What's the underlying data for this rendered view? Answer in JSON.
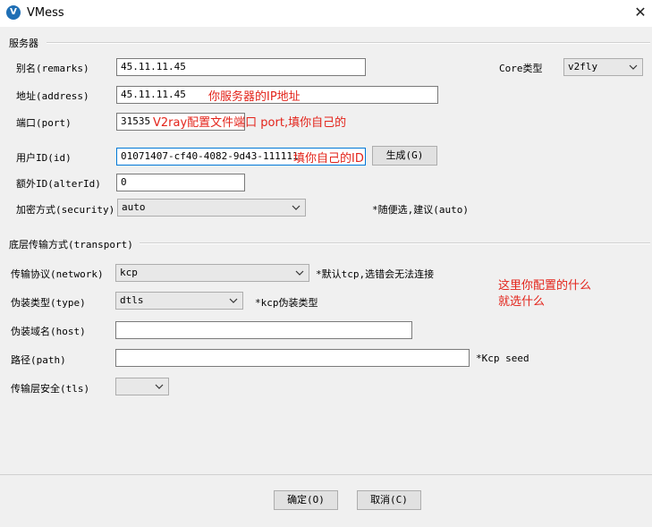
{
  "window": {
    "title": "VMess",
    "icon_letter": "V"
  },
  "server_group": {
    "title": "服务器"
  },
  "fields": {
    "remarks": {
      "label": "别名(remarks)",
      "value": "45.11.11.45"
    },
    "core_type": {
      "label": "Core类型",
      "value": "v2fly"
    },
    "address": {
      "label": "地址(address)",
      "value": "45.11.11.45",
      "note": "你服务器的IP地址"
    },
    "port": {
      "label": "端口(port)",
      "value": "31535",
      "note": "V2ray配置文件端口 port,填你自己的"
    },
    "id": {
      "label": "用户ID(id)",
      "value": "01071407-cf40-4082-9d43-111111",
      "note": "填你自己的ID"
    },
    "generate_button": "生成(G)",
    "alter_id": {
      "label": "额外ID(alterId)",
      "value": "0"
    },
    "security": {
      "label": "加密方式(security)",
      "value": "auto",
      "hint": "*随便选,建议(auto)"
    }
  },
  "transport_group": {
    "title": "底层传输方式(transport)"
  },
  "transport": {
    "network": {
      "label": "传输协议(network)",
      "value": "kcp",
      "hint": "*默认tcp,选错会无法连接"
    },
    "type": {
      "label": "伪装类型(type)",
      "value": "dtls",
      "hint": "*kcp伪装类型"
    },
    "host": {
      "label": "伪装域名(host)",
      "value": ""
    },
    "path": {
      "label": "路径(path)",
      "value": "",
      "hint": "*Kcp seed"
    },
    "tls": {
      "label": "传输层安全(tls)",
      "value": ""
    },
    "note_line1": "这里你配置的什么",
    "note_line2": "就选什么"
  },
  "buttons": {
    "ok": "确定(O)",
    "cancel": "取消(C)"
  },
  "colors": {
    "annotation": "#e3241b",
    "accent": "#1f6fb5"
  }
}
